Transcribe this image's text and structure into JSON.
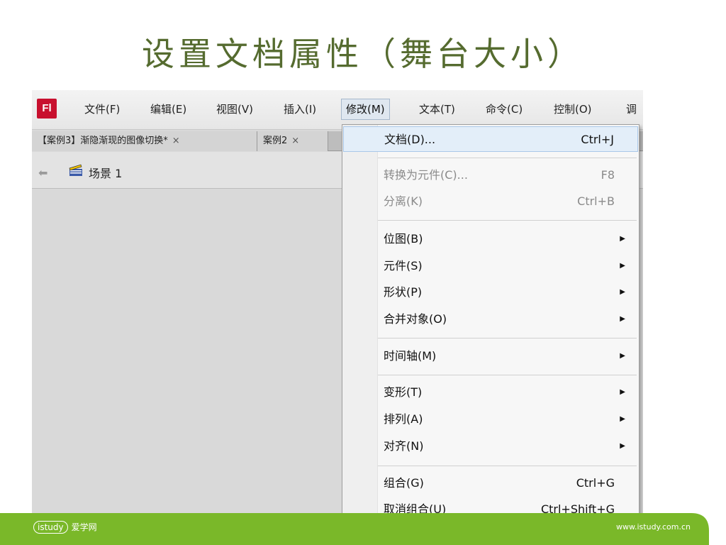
{
  "slide_title": "设置文档属性（舞台大小）",
  "app_logo": "Fl",
  "menubar": {
    "items": [
      "文件(F)",
      "编辑(E)",
      "视图(V)",
      "插入(I)",
      "修改(M)",
      "文本(T)",
      "命令(C)",
      "控制(O)",
      "调"
    ]
  },
  "tabs": [
    {
      "label": "【案例3】渐隐渐现的图像切换*",
      "close": "×"
    },
    {
      "label": "案例2",
      "close": "×"
    }
  ],
  "scene": {
    "label": "场景 1"
  },
  "dropdown": {
    "items": [
      {
        "label": "文档(D)...",
        "shortcut": "Ctrl+J"
      },
      {
        "label": "转换为元件(C)...",
        "shortcut": "F8"
      },
      {
        "label": "分离(K)",
        "shortcut": "Ctrl+B"
      },
      {
        "label": "位图(B)",
        "arrow": "▶"
      },
      {
        "label": "元件(S)",
        "arrow": "▶"
      },
      {
        "label": "形状(P)",
        "arrow": "▶"
      },
      {
        "label": "合并对象(O)",
        "arrow": "▶"
      },
      {
        "label": "时间轴(M)",
        "arrow": "▶"
      },
      {
        "label": "变形(T)",
        "arrow": "▶"
      },
      {
        "label": "排列(A)",
        "arrow": "▶"
      },
      {
        "label": "对齐(N)",
        "arrow": "▶"
      },
      {
        "label": "组合(G)",
        "shortcut": "Ctrl+G"
      },
      {
        "label": "取消组合(U)",
        "shortcut": "Ctrl+Shift+G"
      }
    ]
  },
  "footer": {
    "logo": "istudy",
    "logo_cn": "爱学网",
    "url": "www.istudy.com.cn"
  },
  "colors": {
    "title": "#556b2f",
    "footer_green": "#7ab829",
    "logo_red": "#c8102e"
  }
}
